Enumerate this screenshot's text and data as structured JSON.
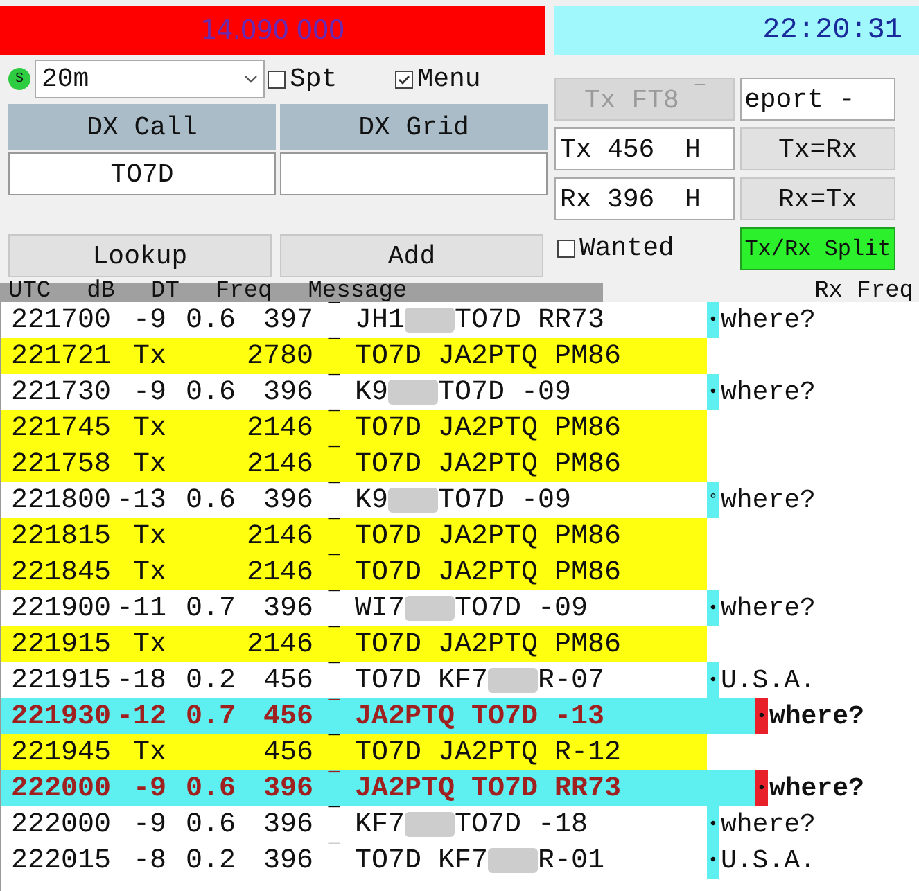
{
  "frequency": "14.090 000",
  "clock": "22:20:31",
  "status_light": "S",
  "band": {
    "value": "20m"
  },
  "checkboxes": [
    {
      "label": "Spt",
      "checked": false
    },
    {
      "label": "Menu",
      "checked": true
    }
  ],
  "dx_call": {
    "label": "DX Call",
    "value": "TO7D"
  },
  "dx_grid": {
    "label": "DX Grid"
  },
  "tx_mode_button": {
    "label": "Tx FT8",
    "mark": "¯",
    "disabled": true
  },
  "report_spin": {
    "value": "eport -"
  },
  "tx_freq": {
    "label": "Tx",
    "value": "456",
    "unit": "H"
  },
  "rx_freq": {
    "label": "Rx",
    "value": "396",
    "unit": "H"
  },
  "tx_eq_rx": "Tx=Rx",
  "rx_eq_tx": "Rx=Tx",
  "lookup": "Lookup",
  "add": "Add",
  "wanted": {
    "label": "Wanted",
    "checked": false
  },
  "split": {
    "label": "Tx/Rx Split",
    "on": true
  },
  "columns": [
    "UTC",
    "dB",
    "DT",
    "Freq",
    "Message"
  ],
  "right_header": "Rx Freq",
  "rows": [
    {
      "kind": "rx",
      "time": "221700",
      "db": "-9",
      "dt": "0.6",
      "freq": "397",
      "mark": "¯",
      "message": "JH1",
      "redacted": true,
      "message_end": "TO7D RR73",
      "marker": "•",
      "color": "#5ef0f0",
      "country": "where?"
    },
    {
      "kind": "tx",
      "time": "221721",
      "db": "Tx",
      "freq": "2780",
      "mark": "¯",
      "message": "TO7D JA2PTQ PM86"
    },
    {
      "kind": "rx",
      "time": "221730",
      "db": "-9",
      "dt": "0.6",
      "freq": "396",
      "mark": "¯",
      "message": "K9",
      "redacted": true,
      "message_end": "TO7D -09",
      "marker": "•",
      "color": "#5ef0f0",
      "country": "where?"
    },
    {
      "kind": "tx",
      "time": "221745",
      "db": "Tx",
      "freq": "2146",
      "mark": "¯",
      "message": "TO7D JA2PTQ PM86"
    },
    {
      "kind": "tx",
      "time": "221758",
      "db": "Tx",
      "freq": "2146",
      "mark": "¯",
      "message": "TO7D JA2PTQ PM86"
    },
    {
      "kind": "rx",
      "time": "221800",
      "db": "-13",
      "dt": "0.6",
      "freq": "396",
      "mark": "¯",
      "message": "K9",
      "redacted": true,
      "message_end": "TO7D -09",
      "marker": "°",
      "color": "#5ef0f0",
      "country": "where?"
    },
    {
      "kind": "tx",
      "time": "221815",
      "db": "Tx",
      "freq": "2146",
      "mark": "¯",
      "message": "TO7D JA2PTQ PM86"
    },
    {
      "kind": "tx",
      "time": "221845",
      "db": "Tx",
      "freq": "2146",
      "mark": "¯",
      "message": "TO7D JA2PTQ PM86"
    },
    {
      "kind": "rx",
      "time": "221900",
      "db": "-11",
      "dt": "0.7",
      "freq": "396",
      "mark": "¯",
      "message": "WI7",
      "redacted": true,
      "message_end": "TO7D -09",
      "marker": "•",
      "color": "#5ef0f0",
      "country": "where?"
    },
    {
      "kind": "tx",
      "time": "221915",
      "db": "Tx",
      "freq": "2146",
      "mark": "¯",
      "message": "TO7D JA2PTQ PM86"
    },
    {
      "kind": "rx",
      "time": "221915",
      "db": "-18",
      "dt": "0.2",
      "freq": "456",
      "mark": "¯",
      "message": "TO7D KF7",
      "redacted": true,
      "message_end": "R-07",
      "marker": "•",
      "color": "#5ef0f0",
      "country": "U.S.A."
    },
    {
      "kind": "mine",
      "time": "221930",
      "db": "-12",
      "dt": "0.7",
      "freq": "456",
      "mark": "¯",
      "message": "JA2PTQ TO7D -13",
      "marker": "•",
      "color": "#e8202a",
      "country": "where?"
    },
    {
      "kind": "tx",
      "time": "221945",
      "db": "Tx",
      "freq": "456",
      "mark": "¯",
      "message": "TO7D JA2PTQ R-12"
    },
    {
      "kind": "mine",
      "time": "222000",
      "db": "-9",
      "dt": "0.6",
      "freq": "396",
      "mark": "¯",
      "message": "JA2PTQ TO7D RR73",
      "marker": "•",
      "color": "#e8202a",
      "country": "where?"
    },
    {
      "kind": "rx",
      "time": "222000",
      "db": "-9",
      "dt": "0.6",
      "freq": "396",
      "mark": "¯",
      "message": "KF7",
      "redacted": true,
      "message_end": "TO7D -18",
      "marker": "•",
      "color": "#5ef0f0",
      "country": "where?"
    },
    {
      "kind": "rx",
      "time": "222015",
      "db": "-8",
      "dt": "0.2",
      "freq": "396",
      "mark": "¯",
      "message": "TO7D KF7",
      "redacted": true,
      "message_end": "R-01",
      "marker": "•",
      "color": "#5ef0f0",
      "country": "U.S.A."
    }
  ]
}
